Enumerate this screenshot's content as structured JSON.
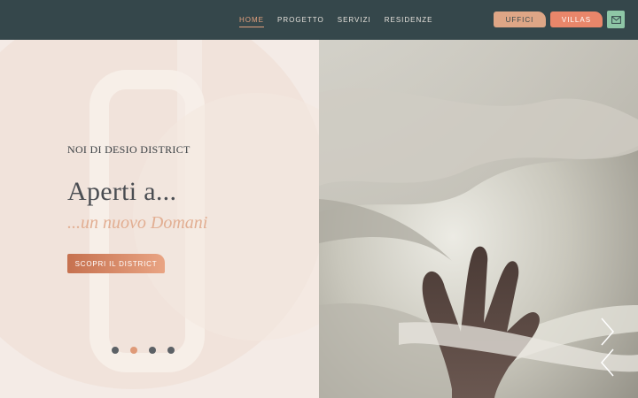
{
  "nav": {
    "items": [
      {
        "label": "HOME",
        "active": true
      },
      {
        "label": "PROGETTO",
        "active": false
      },
      {
        "label": "SERVIZI",
        "active": false
      },
      {
        "label": "RESIDENZE",
        "active": false
      }
    ],
    "uffici_label": "UFFICI",
    "villas_label": "VILLAS",
    "mail_icon": "mail-icon"
  },
  "hero": {
    "subtitle": "NOI DI DESIO DISTRICT",
    "headline": "Aperti a...",
    "tagline": "...un nuovo Domani",
    "cta_label": "SCOPRI IL DISTRICT",
    "slides_total": 4,
    "slide_active_index": 1
  },
  "colors": {
    "topbar": "#35474b",
    "accent": "#e9866a",
    "mail_button": "#8ec6a6",
    "panel_background": "#f4ebe6"
  }
}
